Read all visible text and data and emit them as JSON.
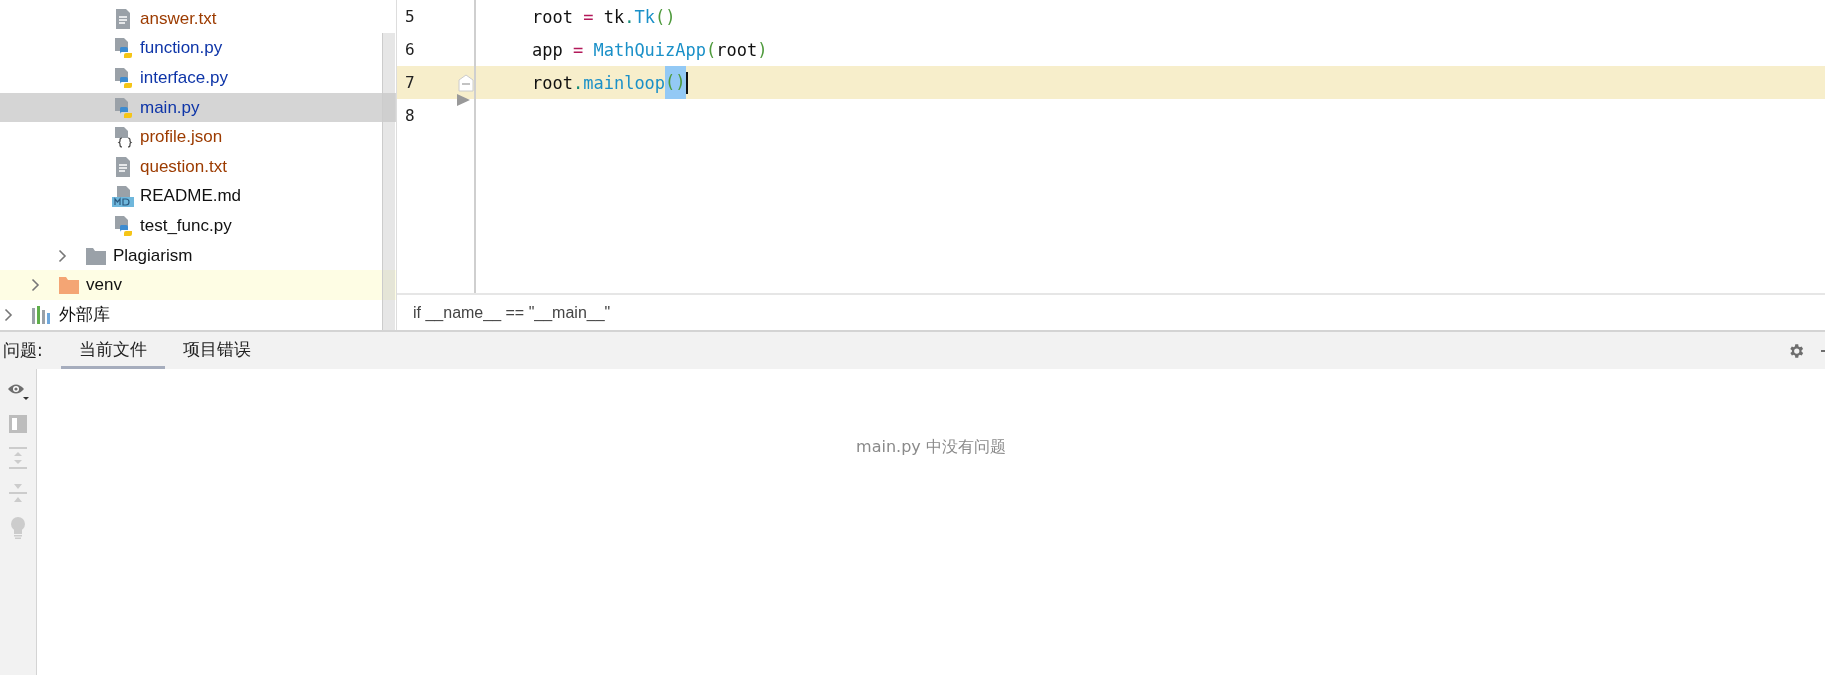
{
  "project_tree": [
    {
      "children": [
        {
          "children": [
            {
              "children": [
                {
                  "label": "answer.txt",
                  "kind": "text",
                  "color": "#9c3b00",
                  "selected": false,
                  "highlighted": false
                },
                {
                  "label": "function.py",
                  "kind": "python",
                  "color": "#0e35a8",
                  "selected": false,
                  "highlighted": false
                },
                {
                  "label": "interface.py",
                  "kind": "python",
                  "color": "#0e35a8",
                  "selected": false,
                  "highlighted": false
                },
                {
                  "label": "main.py",
                  "kind": "python",
                  "color": "#0e35a8",
                  "selected": true,
                  "highlighted": false
                },
                {
                  "label": "profile.json",
                  "kind": "json",
                  "color": "#9c3b00",
                  "selected": false,
                  "highlighted": false
                },
                {
                  "label": "question.txt",
                  "kind": "text",
                  "color": "#9c3b00",
                  "selected": false,
                  "highlighted": false
                },
                {
                  "label": "README.md",
                  "kind": "markdown",
                  "color": "#111111",
                  "selected": false,
                  "highlighted": false
                },
                {
                  "label": "test_func.py",
                  "kind": "python",
                  "color": "#111111",
                  "selected": false,
                  "highlighted": false
                }
              ]
            },
            {
              "label": "Plagiarism",
              "kind": "folder",
              "color": "#111111",
              "selected": false,
              "highlighted": false,
              "expanded": false
            }
          ]
        },
        {
          "label": "venv",
          "kind": "excluded-folder",
          "color": "#111111",
          "selected": false,
          "highlighted": true,
          "expanded": false
        }
      ]
    },
    {
      "label": "外部库",
      "kind": "library",
      "color": "#111111",
      "selected": false,
      "highlighted": false,
      "expanded": false
    }
  ],
  "editor": {
    "lines": [
      {
        "number": "5",
        "current": false,
        "tokens": [
          {
            "text": "root",
            "kind": "plain"
          },
          {
            "text": " = ",
            "kind": "op"
          },
          {
            "text": "tk",
            "kind": "plain"
          },
          {
            "text": ".",
            "kind": "dot"
          },
          {
            "text": "Tk",
            "kind": "call"
          },
          {
            "text": "()",
            "kind": "paren"
          }
        ]
      },
      {
        "number": "6",
        "current": false,
        "tokens": [
          {
            "text": "app",
            "kind": "plain"
          },
          {
            "text": " = ",
            "kind": "op"
          },
          {
            "text": "MathQuizApp",
            "kind": "call"
          },
          {
            "text": "(",
            "kind": "paren"
          },
          {
            "text": "root",
            "kind": "plain"
          },
          {
            "text": ")",
            "kind": "paren"
          }
        ]
      },
      {
        "number": "7",
        "current": true,
        "tokens": [
          {
            "text": "root",
            "kind": "plain"
          },
          {
            "text": ".",
            "kind": "dot"
          },
          {
            "text": "mainloop",
            "kind": "call"
          },
          {
            "text": "()",
            "kind": "paren-match"
          }
        ]
      },
      {
        "number": "8",
        "current": false
      }
    ],
    "breadcrumb": "if __name__ == \"__main__\""
  },
  "problems": {
    "label": "问题:",
    "tabs": [
      {
        "label": "当前文件",
        "selected": true
      },
      {
        "label": "项目错误",
        "selected": false
      }
    ],
    "empty_message": "main.py 中没有问题"
  }
}
